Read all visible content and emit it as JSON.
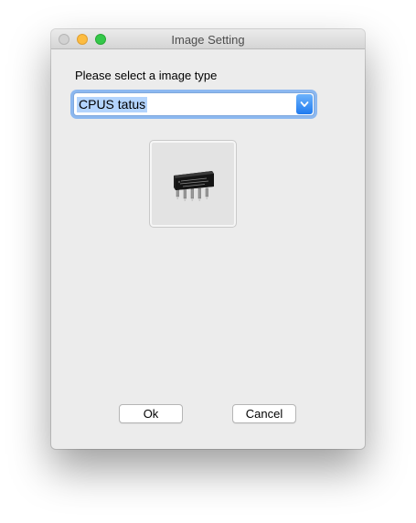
{
  "window": {
    "title": "Image Setting"
  },
  "form": {
    "prompt": "Please select a image type",
    "image_type_select": {
      "selected": "CPUS tatus"
    },
    "preview_icon": "cpu-chip-icon"
  },
  "buttons": {
    "ok_label": "Ok",
    "cancel_label": "Cancel"
  },
  "colors": {
    "focus_ring": "#8cb8f0",
    "select_arrow": "#1f7bf0",
    "traffic_close": "#d2d2d2",
    "traffic_minimize": "#fdbc40",
    "traffic_maximize": "#34c84a"
  }
}
